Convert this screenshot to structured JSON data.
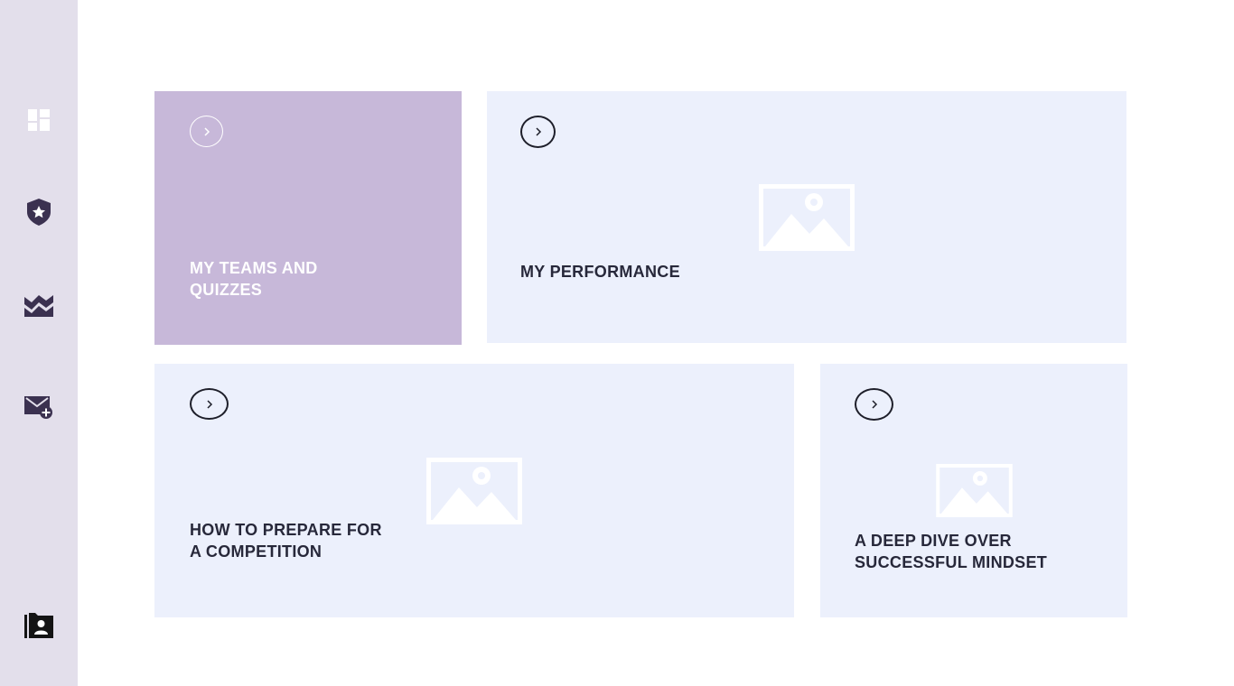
{
  "sidebar": {
    "items": [
      {
        "icon": "dashboard-icon"
      },
      {
        "icon": "badge-star-icon"
      },
      {
        "icon": "chart-area-icon"
      },
      {
        "icon": "mail-add-icon"
      },
      {
        "icon": "contact-folder-icon"
      }
    ]
  },
  "cards": [
    {
      "title": "MY TEAMS AND\nQUIZZES",
      "icon": "chevron-right-icon"
    },
    {
      "title": "MY PERFORMANCE",
      "icon": "chevron-right-icon",
      "image": "image-placeholder-icon"
    },
    {
      "title": "HOW TO PREPARE FOR\nA COMPETITION",
      "icon": "chevron-right-icon",
      "image": "image-placeholder-icon"
    },
    {
      "title": "A DEEP DIVE OVER\nSUCCESSFUL MINDSET",
      "icon": "chevron-right-icon",
      "image": "image-placeholder-icon"
    }
  ],
  "colors": {
    "sidebar_bg": "#e3dfeb",
    "card_light": "#ecf0fc",
    "card_accent": "#c7b8d9",
    "icon_dark": "#3b3150",
    "text_dark": "#27283a"
  }
}
